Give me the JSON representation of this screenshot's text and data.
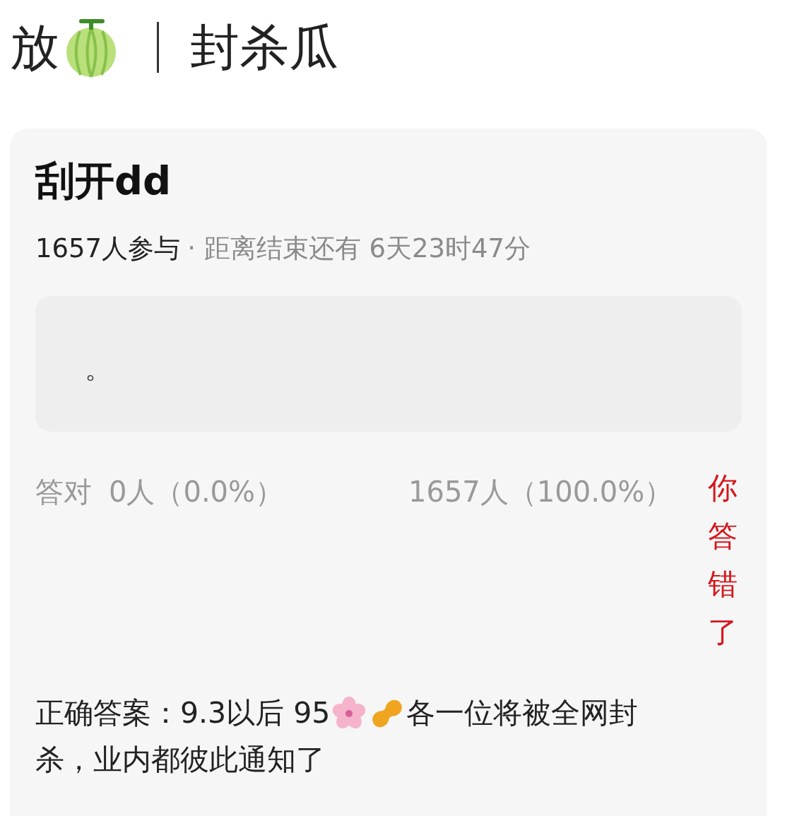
{
  "header": {
    "title_start": "放",
    "title_end": "封杀瓜"
  },
  "quiz": {
    "title": "刮开dd",
    "participants": "1657人参与",
    "countdown": "· 距离结束还有 6天23时47分",
    "scratch_text": "。",
    "correct_label": "答对",
    "correct_count": "0人（0.0%）",
    "wrong_count": "1657人（100.0%）",
    "result": "你答错了",
    "answer_start": "正确答案：9.3以后 95",
    "answer_end": "各一位将被全网封",
    "answer_line_2": "杀，业内都彼此通知了"
  }
}
